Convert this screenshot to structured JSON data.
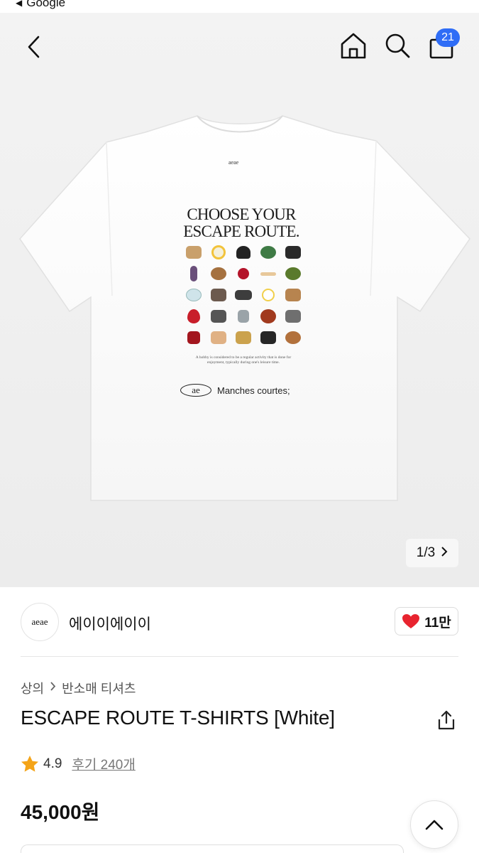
{
  "status": {
    "back_label": "Google"
  },
  "header": {
    "cart_count": "21"
  },
  "gallery": {
    "print_line1": "CHOOSE YOUR",
    "print_line2": "ESCAPE ROUTE.",
    "print_fine": "A hobby is considered to be a regular activity that is done for enjoyment, typically during one's leisure time.",
    "print_logo": "ae",
    "print_signature": "Manches courtes;",
    "collar_label": "aeae",
    "pager": "1/3"
  },
  "brand": {
    "logo_text": "aeae",
    "name": "에이이에이이",
    "likes": "11만"
  },
  "product": {
    "breadcrumb": [
      "상의",
      "반소매 티셔츠"
    ],
    "title": "ESCAPE ROUTE T-SHIRTS [White]",
    "rating": "4.9",
    "reviews": "후기 240개",
    "price": "45,000원"
  },
  "colors": {
    "accent": "#2f6df6",
    "heart": "#e8242f",
    "star": "#f4a418"
  }
}
